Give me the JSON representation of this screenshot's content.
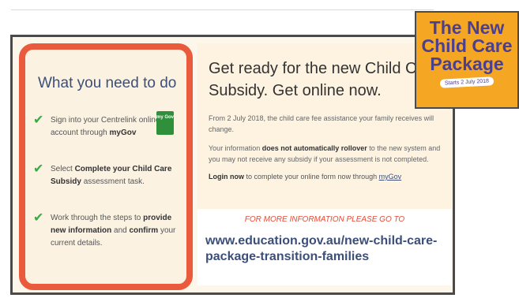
{
  "left": {
    "title": "What you need to do",
    "items": [
      {
        "pre": "Sign into your Centrelink online account through ",
        "bold": "myGov",
        "post": ""
      },
      {
        "pre": "Select ",
        "bold": "Complete your Child Care Subsidy",
        "post": " assessment task."
      },
      {
        "pre": "Work through the steps to ",
        "bold": "provide new information",
        "post": " and ",
        "bold2": "confirm",
        "post2": " your current details."
      }
    ],
    "mygov_label": "my Gov"
  },
  "right": {
    "headline": "Get ready for the new Child Care Subsidy. Get online now.",
    "para1": "From 2 July 2018, the child care fee assistance your family receives will change.",
    "para2_pre": "Your information ",
    "para2_bold": "does not automatically rollover",
    "para2_post": " to the new system and you may not receive any subsidy if your assessment is not completed.",
    "login_bold": "Login now",
    "login_text": " to complete your online form now through ",
    "login_link": "myGov"
  },
  "info": {
    "more": "For more information please go to",
    "url": "www.education.gov.au/new-child-care-package-transition-families"
  },
  "badge": {
    "title": "The New Child Care Package",
    "subtitle": "Starts 2 July 2018"
  },
  "colors": {
    "accent_red": "#ea5a3c",
    "navy": "#3b4f7a",
    "green_check": "#3ca84a",
    "badge_orange": "#f5a623"
  }
}
